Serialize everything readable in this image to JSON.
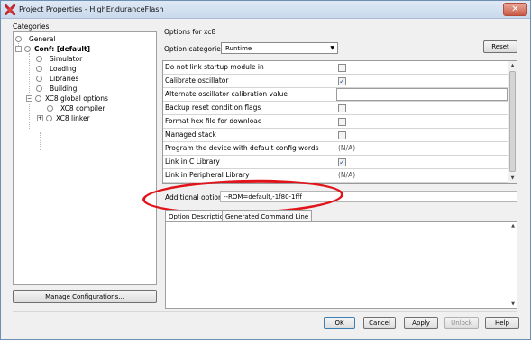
{
  "window": {
    "title": "Project Properties - HighEnduranceFlash",
    "close_glyph": "✕",
    "accent_color": "#e1141b"
  },
  "categories": {
    "label": "Categories:",
    "toggle_collapse": "−",
    "toggle_expand": "+",
    "nodes": [
      {
        "label": "General"
      },
      {
        "label": "Conf: [default]"
      },
      {
        "label": "Simulator"
      },
      {
        "label": "Loading"
      },
      {
        "label": "Libraries"
      },
      {
        "label": "Building"
      },
      {
        "label": "XC8 global options"
      },
      {
        "label": "XC8 compiler"
      },
      {
        "label": "XC8 linker"
      }
    ],
    "manage_button": "Manage Configurations..."
  },
  "options": {
    "header": "Options for xc8",
    "category_label": "Option categories:",
    "category_value": "Runtime",
    "reset_button": "Reset",
    "rows": [
      {
        "name": "Do not link startup module in",
        "checked": ""
      },
      {
        "name": "Calibrate oscillator",
        "checked": "✓"
      },
      {
        "name": "Alternate oscillator calibration value",
        "value": ""
      },
      {
        "name": "Backup reset condition flags",
        "checked": ""
      },
      {
        "name": "Format hex file for download",
        "checked": ""
      },
      {
        "name": "Managed stack",
        "checked": ""
      },
      {
        "name": "Program the device with default config words",
        "value": "(N/A)"
      },
      {
        "name": "Link in C Library",
        "checked": "✓"
      },
      {
        "name": "Link in Peripheral Library",
        "value": "(N/A)"
      }
    ],
    "scroll_up": "▲",
    "scroll_down": "▼",
    "additional_label": "Additional options:",
    "additional_value": "--ROM=default,-1f80-1fff",
    "tabs": [
      {
        "label": "Option Description"
      },
      {
        "label": "Generated Command Line"
      }
    ]
  },
  "footer": {
    "ok": "OK",
    "cancel": "Cancel",
    "apply": "Apply",
    "unlock": "Unlock",
    "help": "Help"
  }
}
